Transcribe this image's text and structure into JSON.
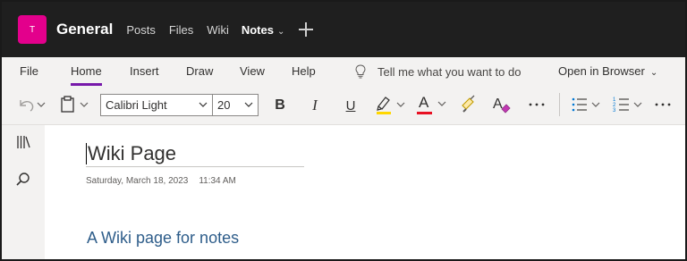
{
  "colors": {
    "team_avatar": "#e3008c",
    "header_bg": "#1f1f1f",
    "ribbon_accent": "#7719aa",
    "highlight_yellow": "#ffd700",
    "font_red": "#e81123",
    "heading_blue": "#2e5d8a"
  },
  "header": {
    "team_initial": "T",
    "channel_name": "General",
    "tabs": [
      {
        "label": "Posts"
      },
      {
        "label": "Files"
      },
      {
        "label": "Wiki"
      },
      {
        "label": "Notes"
      }
    ],
    "add_tab_icon": "plus-icon"
  },
  "ribbon": {
    "tabs": [
      {
        "label": "File"
      },
      {
        "label": "Home"
      },
      {
        "label": "Insert"
      },
      {
        "label": "Draw"
      },
      {
        "label": "View"
      },
      {
        "label": "Help"
      }
    ],
    "active_tab": "Home",
    "tell_me": "Tell me what you want to do",
    "open_in_browser": "Open in Browser"
  },
  "toolbar": {
    "font_name": "Calibri Light",
    "font_size": "20",
    "bold": "B",
    "italic": "I",
    "underline": "U",
    "font_color_glyph": "A",
    "icons": [
      "undo-icon",
      "clipboard-icon",
      "highlighter-icon",
      "font-color-icon",
      "format-painter-icon",
      "clear-formatting-icon",
      "more-icon",
      "bullets-icon",
      "numbering-icon",
      "more-icon"
    ]
  },
  "rail": {
    "icons": [
      "notebooks-icon",
      "search-icon"
    ]
  },
  "page": {
    "title": "Wiki Page",
    "date": "Saturday, March 18, 2023",
    "time": "11:34 AM",
    "heading": "A Wiki page for notes"
  }
}
